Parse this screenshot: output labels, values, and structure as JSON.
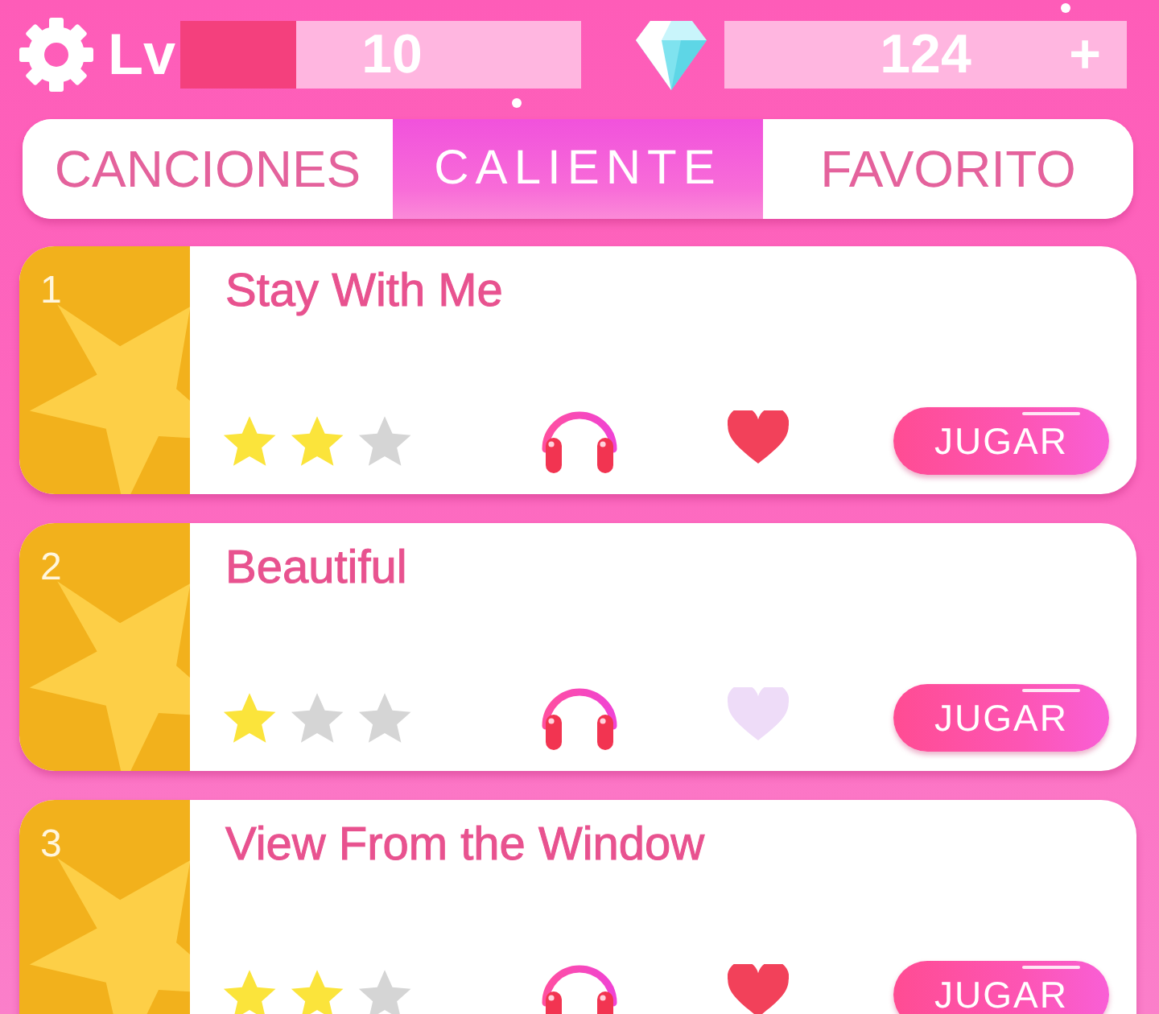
{
  "top_bar": {
    "level_label": "Lv",
    "level_meter": {
      "value": "10",
      "level": 0.29
    },
    "gems": {
      "value": "124",
      "add_label": "+"
    }
  },
  "tabs": [
    {
      "label": "CANCIONES",
      "selected": false
    },
    {
      "label": "CALIENTE",
      "selected": true
    },
    {
      "label": "FAVORITO",
      "selected": false
    }
  ],
  "songs": [
    {
      "rank": "1",
      "title": "Stay With Me",
      "stars": 2,
      "favorite": true,
      "play_label": "JUGAR"
    },
    {
      "rank": "2",
      "title": "Beautiful",
      "stars": 1,
      "favorite": false,
      "play_label": "JUGAR"
    },
    {
      "rank": "3",
      "title": "View From the Window",
      "stars": 2,
      "favorite": true,
      "play_label": "JUGAR"
    }
  ]
}
